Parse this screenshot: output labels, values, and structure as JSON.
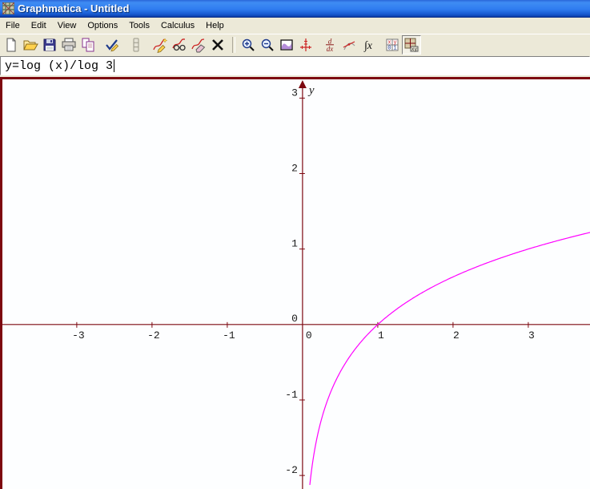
{
  "window": {
    "title": "Graphmatica - Untitled"
  },
  "menu": {
    "items": [
      "File",
      "Edit",
      "View",
      "Options",
      "Tools",
      "Calculus",
      "Help"
    ]
  },
  "toolbar": {
    "buttons": [
      "new-file",
      "open-file",
      "save-file",
      "print",
      "copy-graphs",
      "redraw-all",
      "redraw-queue",
      "draw-graph",
      "annotate-graph",
      "hide-graph",
      "delete-graph",
      "zoom-in",
      "zoom-out",
      "grid-range",
      "default-grid",
      "find-derivative",
      "draw-tangent",
      "integrate",
      "point-tables",
      "graph-paper"
    ],
    "derivative_numerator": "d",
    "derivative_denominator": "dx",
    "integral_label": "∫x",
    "table_cells": [
      "x",
      "y",
      "0",
      "1"
    ],
    "paper_label": "xy"
  },
  "equation_input": {
    "value": "y=log (x)/log 3"
  },
  "chart_data": {
    "type": "line",
    "title": "",
    "equation": "y=log (x)/log 3",
    "series": [
      {
        "name": "y=log (x)/log 3",
        "fn": "log",
        "base": 3,
        "color": "#FF00FF"
      }
    ],
    "x_ticks": [
      -3,
      -2,
      -1,
      0,
      1,
      2,
      3
    ],
    "y_ticks": [
      -2,
      -1,
      0,
      1,
      2,
      3
    ],
    "xlim": [
      -4.02,
      3.82
    ],
    "ylim": [
      -2.19,
      3.28
    ],
    "y_axis_label": "y",
    "axis_color": "#7D0810",
    "tick_label_color": "#1a1a1a",
    "grid": false,
    "background": "#FDFEFF"
  }
}
